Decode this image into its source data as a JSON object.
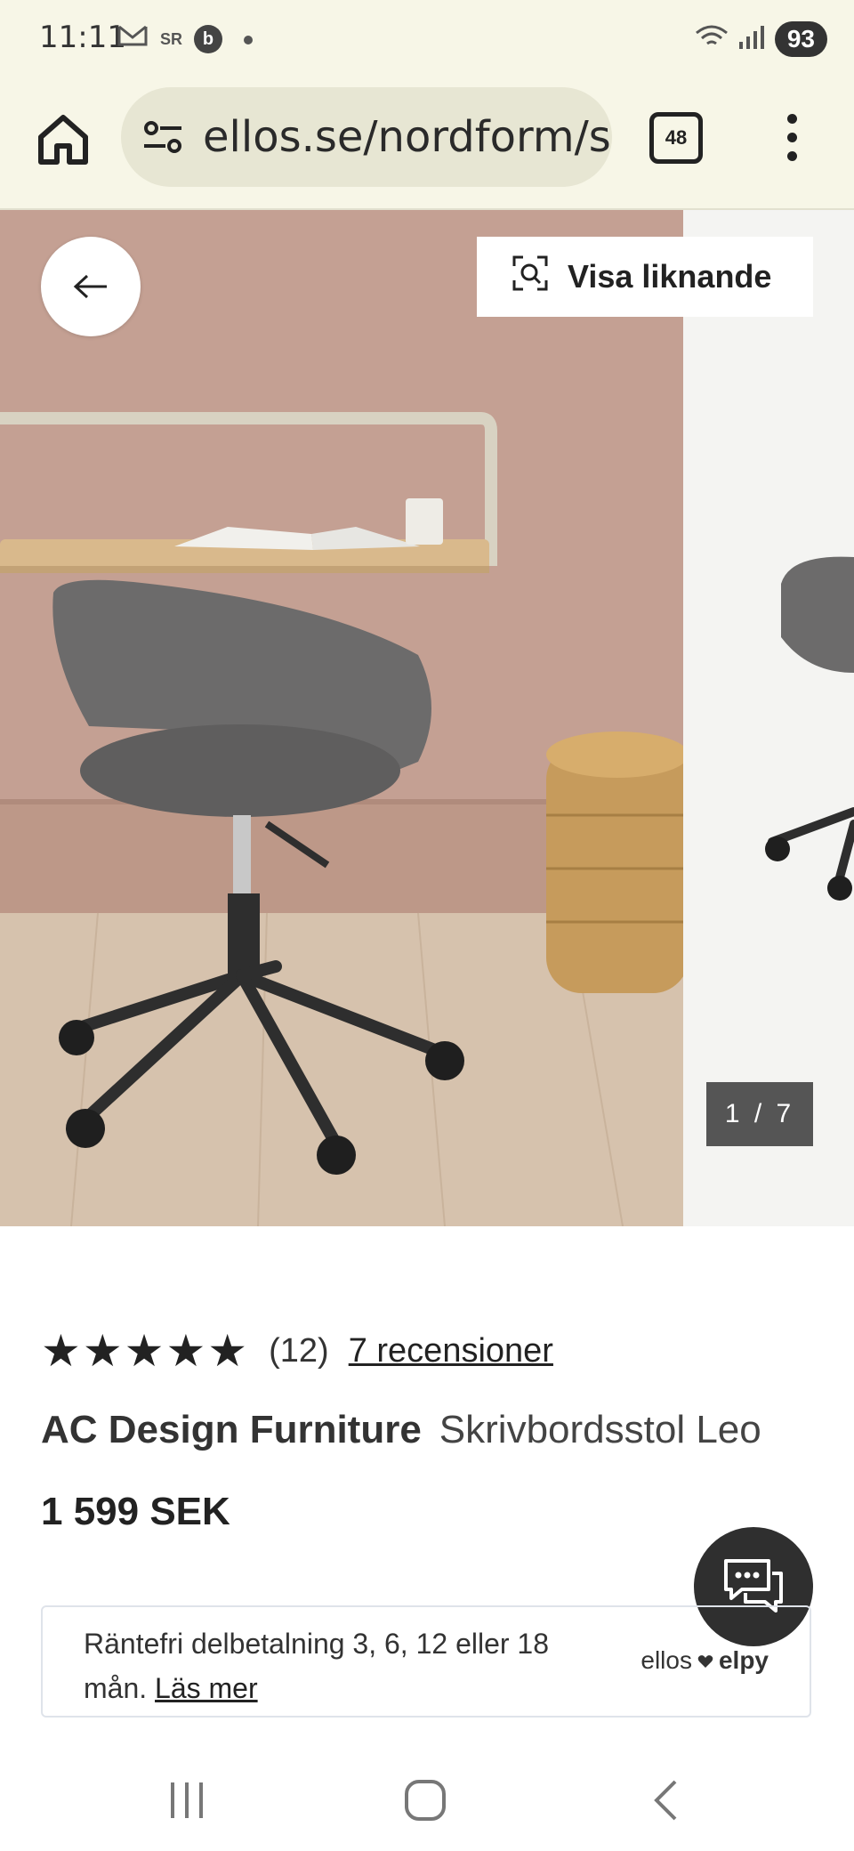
{
  "status_bar": {
    "time": "11:11",
    "badge": "b",
    "battery": "93",
    "icons": [
      "gmail-icon",
      "sr-icon",
      "wifi-icon",
      "signal-icon"
    ]
  },
  "browser": {
    "url": "ellos.se/nordform/s",
    "tab_count": "48"
  },
  "gallery": {
    "similar_label": "Visa liknande",
    "counter": "1 / 7"
  },
  "product": {
    "stars": "★★★★★",
    "rating_count": "(12)",
    "reviews_link": "7 recensioner",
    "brand": "AC Design Furniture",
    "name": "Skrivbordsstol Leo",
    "price": "1 599 SEK"
  },
  "finance": {
    "text": "Räntefri delbetalning 3, 6, 12 eller 18 mån.",
    "link": "Läs mer",
    "logo_left": "ellos",
    "logo_right": "elpy"
  },
  "colors": {
    "browser_bg": "#f7f6e7",
    "wall": "#c4a093",
    "floor": "#d6c2ad",
    "chair": "#6c6b6b",
    "fab": "#2f2f2f"
  }
}
